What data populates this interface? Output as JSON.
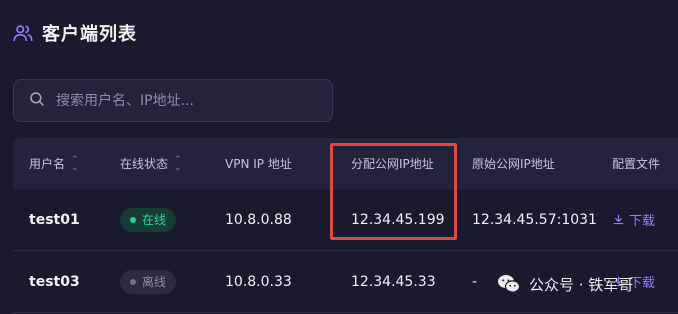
{
  "page": {
    "title": "客户端列表",
    "accent_color": "#8f7dff"
  },
  "search": {
    "placeholder": "搜索用户名、IP地址..."
  },
  "table": {
    "columns": [
      "用户名",
      "在线状态",
      "VPN IP 地址",
      "分配公网IP地址",
      "原始公网IP地址",
      "配置文件"
    ],
    "rows": [
      {
        "username": "test01",
        "status": "在线",
        "vpn_ip": "10.8.0.88",
        "assigned_ip": "12.34.45.199",
        "original_ip": "12.34.45.57:1031",
        "config": "下载"
      },
      {
        "username": "test03",
        "status": "离线",
        "vpn_ip": "10.8.0.33",
        "assigned_ip": "12.34.45.33",
        "original_ip": "-",
        "config": "下载"
      }
    ]
  },
  "colors": {
    "online": "#35d39a",
    "offline": "#8b8ea4",
    "highlight": "#e04848"
  },
  "watermark": {
    "text": "公众号 · 铁军哥"
  }
}
